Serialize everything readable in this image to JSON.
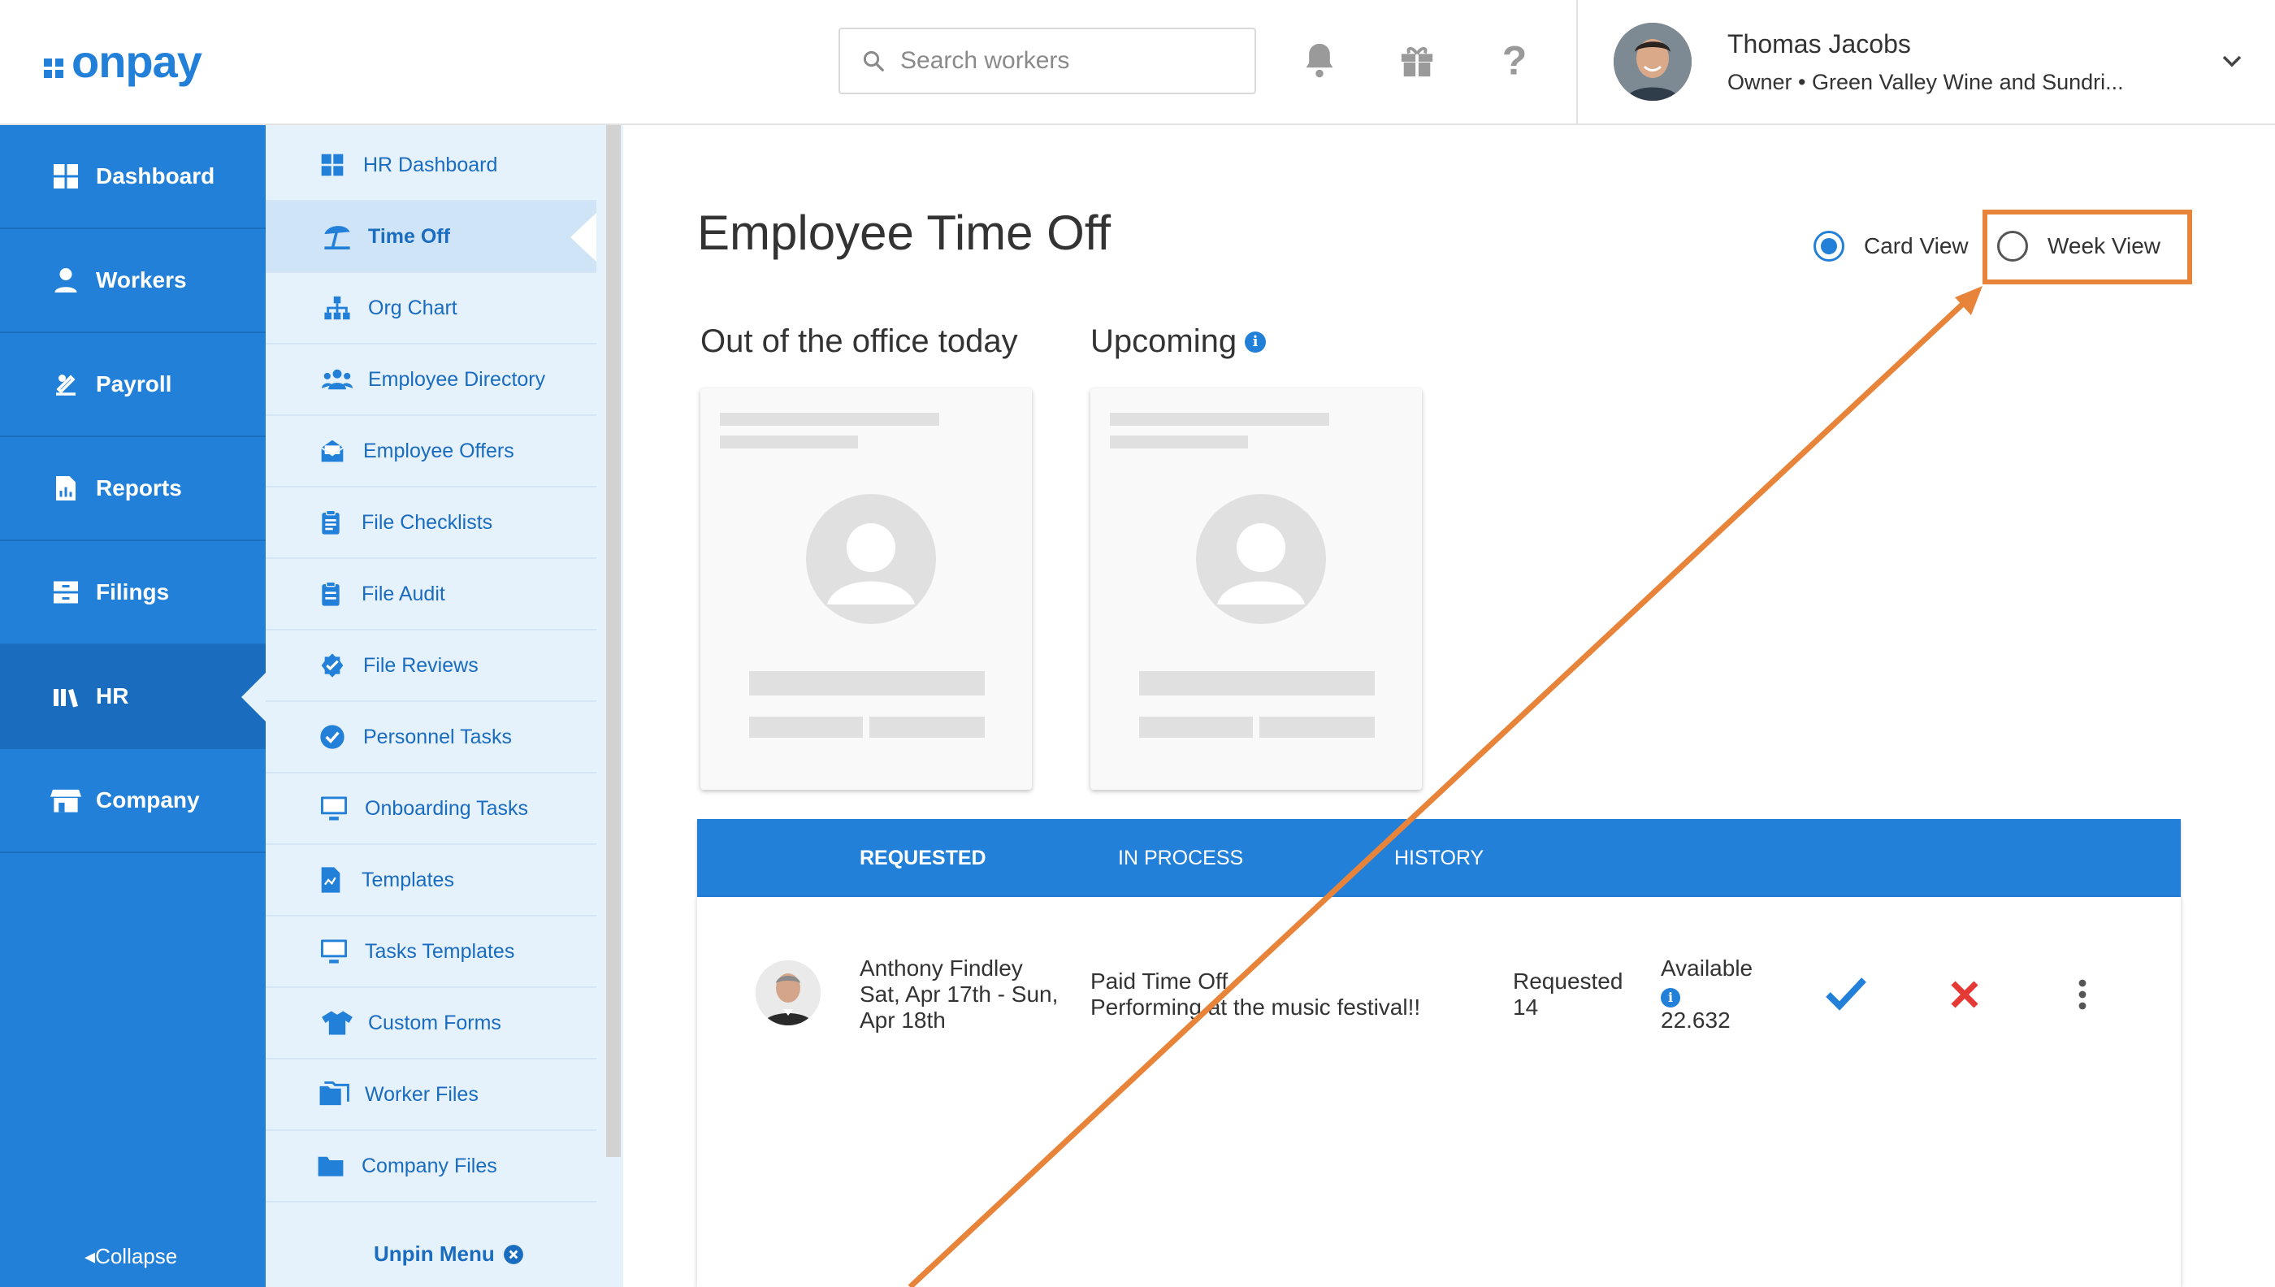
{
  "brand": {
    "logo_text": "onpay"
  },
  "search": {
    "placeholder": "Search workers"
  },
  "user": {
    "name": "Thomas Jacobs",
    "subtitle": "Owner • Green Valley Wine and Sundri..."
  },
  "main_nav": {
    "items": [
      {
        "label": "Dashboard",
        "icon": "dashboard-icon"
      },
      {
        "label": "Workers",
        "icon": "workers-icon"
      },
      {
        "label": "Payroll",
        "icon": "payroll-icon"
      },
      {
        "label": "Reports",
        "icon": "reports-icon"
      },
      {
        "label": "Filings",
        "icon": "filings-icon"
      },
      {
        "label": "HR",
        "icon": "hr-icon",
        "active": true
      },
      {
        "label": "Company",
        "icon": "company-icon"
      }
    ],
    "collapse_label": "Collapse"
  },
  "sub_nav": {
    "items": [
      {
        "label": "HR Dashboard",
        "icon": "grid-icon"
      },
      {
        "label": "Time Off",
        "icon": "beach-umbrella-icon",
        "active": true
      },
      {
        "label": "Org Chart",
        "icon": "org-chart-icon"
      },
      {
        "label": "Employee Directory",
        "icon": "people-icon"
      },
      {
        "label": "Employee Offers",
        "icon": "envelope-icon"
      },
      {
        "label": "File Checklists",
        "icon": "clipboard-icon"
      },
      {
        "label": "File Audit",
        "icon": "clipboard-icon"
      },
      {
        "label": "File Reviews",
        "icon": "badge-check-icon"
      },
      {
        "label": "Personnel Tasks",
        "icon": "check-circle-icon"
      },
      {
        "label": "Onboarding Tasks",
        "icon": "monitor-icon"
      },
      {
        "label": "Templates",
        "icon": "document-icon"
      },
      {
        "label": "Tasks Templates",
        "icon": "monitor-icon"
      },
      {
        "label": "Custom Forms",
        "icon": "shirt-icon"
      },
      {
        "label": "Worker Files",
        "icon": "folders-icon"
      },
      {
        "label": "Company Files",
        "icon": "folder-icon"
      }
    ],
    "unpin_label": "Unpin Menu"
  },
  "page": {
    "title": "Employee Time Off",
    "view_options": {
      "card": "Card View",
      "week": "Week View",
      "selected": "card"
    },
    "sections": {
      "out_today": "Out of the office today",
      "upcoming": "Upcoming"
    }
  },
  "tabs": [
    {
      "label": "REQUESTED",
      "active": true
    },
    {
      "label": "IN PROCESS"
    },
    {
      "label": "HISTORY"
    }
  ],
  "requests": [
    {
      "name": "Anthony Findley",
      "dates": "Sat, Apr 17th - Sun,",
      "dates2": "Apr 18th",
      "type": "Paid Time Off",
      "note": "Performing at the music festival!!",
      "requested_label": "Requested",
      "requested_value": "14",
      "available_label": "Available",
      "available_value": "22.632"
    }
  ],
  "colors": {
    "brand_blue": "#2280d9",
    "annotation_orange": "#e8843a",
    "reject_red": "#e53935"
  }
}
